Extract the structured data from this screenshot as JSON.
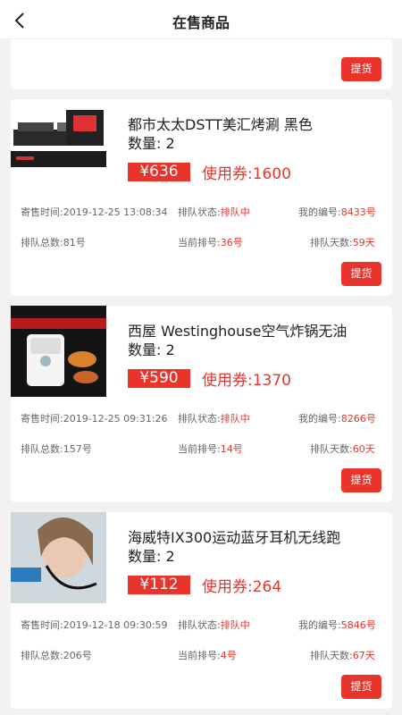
{
  "header": {
    "title": "在售商品"
  },
  "pickup_label": "提货",
  "labels": {
    "sale_time": "寄售时间:",
    "queue_status": "排队状态:",
    "my_number": "我的编号:",
    "queue_total": "排队总数:",
    "current_rank": "当前排号:",
    "queue_days": "排队天数:",
    "qty_prefix": "数量:"
  },
  "items": [
    {
      "name": "都市太太DSTT美汇烤涮 黑色",
      "qty": "2",
      "price": "¥636",
      "coupon": "使用券:1600",
      "sale_time": "2019-12-25 13:08:34",
      "status": "排队中",
      "my_number": "8433号",
      "total": "81号",
      "rank": "36号",
      "days": "59天"
    },
    {
      "name": "西屋 Westinghouse空气炸锅无油",
      "qty": "2",
      "price": "¥590",
      "coupon": "使用券:1370",
      "sale_time": "2019-12-25 09:31:26",
      "status": "排队中",
      "my_number": "8266号",
      "total": "157号",
      "rank": "14号",
      "days": "60天"
    },
    {
      "name": "海威特IX300运动蓝牙耳机无线跑",
      "qty": "2",
      "price": "¥112",
      "coupon": "使用券:264",
      "sale_time": "2019-12-18 09:30:59",
      "status": "排队中",
      "my_number": "5846号",
      "total": "206号",
      "rank": "4号",
      "days": "67天"
    }
  ],
  "colors": {
    "accent": "#e8342a",
    "background": "#f2f2f2"
  }
}
